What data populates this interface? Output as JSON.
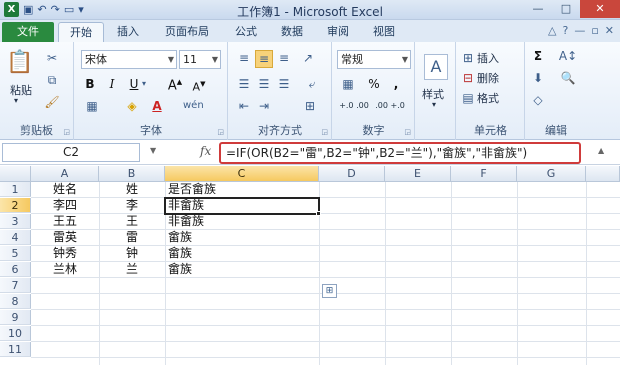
{
  "window": {
    "title": "工作簿1 - Microsoft Excel"
  },
  "quick_access": [
    "save-icon",
    "undo-icon",
    "redo-icon",
    "open-folder-icon"
  ],
  "tabs": [
    {
      "label": "文件"
    },
    {
      "label": "开始"
    },
    {
      "label": "插入"
    },
    {
      "label": "页面布局"
    },
    {
      "label": "公式"
    },
    {
      "label": "数据"
    },
    {
      "label": "审阅"
    },
    {
      "label": "视图"
    }
  ],
  "ribbon": {
    "clipboard": {
      "label": "剪贴板",
      "paste": "粘贴"
    },
    "font": {
      "label": "字体",
      "font_name": "宋体",
      "font_size": "11",
      "bold": "B",
      "italic": "I",
      "underline": "U",
      "font_color_glyph": "A"
    },
    "alignment": {
      "label": "对齐方式"
    },
    "number": {
      "label": "数字",
      "format": "常规",
      "percent": "%",
      "comma": ",",
      "dec_inc": "+.0 .00",
      "dec_dec": ".00 +.0"
    },
    "styles": {
      "label": "样式"
    },
    "cells": {
      "label": "单元格",
      "insert": "插入",
      "delete": "删除",
      "format": "格式"
    },
    "editing": {
      "label": "编辑",
      "sigma": "Σ"
    }
  },
  "formula_bar": {
    "name_box": "C2",
    "fx": "fx",
    "formula": "=IF(OR(B2=\"雷\",B2=\"钟\",B2=\"兰\"),\"畲族\",\"非畲族\")"
  },
  "sheet": {
    "columns": [
      "A",
      "B",
      "C",
      "D",
      "E",
      "F",
      "G"
    ],
    "rows": [
      "1",
      "2",
      "3",
      "4",
      "5",
      "6",
      "7",
      "8",
      "9",
      "10",
      "11"
    ],
    "active_cell": "C2",
    "data": [
      [
        "姓名",
        "姓",
        "是否畲族"
      ],
      [
        "李四",
        "李",
        "非畲族"
      ],
      [
        "王五",
        "王",
        "非畲族"
      ],
      [
        "雷英",
        "雷",
        "畲族"
      ],
      [
        "钟秀",
        "钟",
        "畲族"
      ],
      [
        "兰林",
        "兰",
        "畲族"
      ]
    ]
  }
}
